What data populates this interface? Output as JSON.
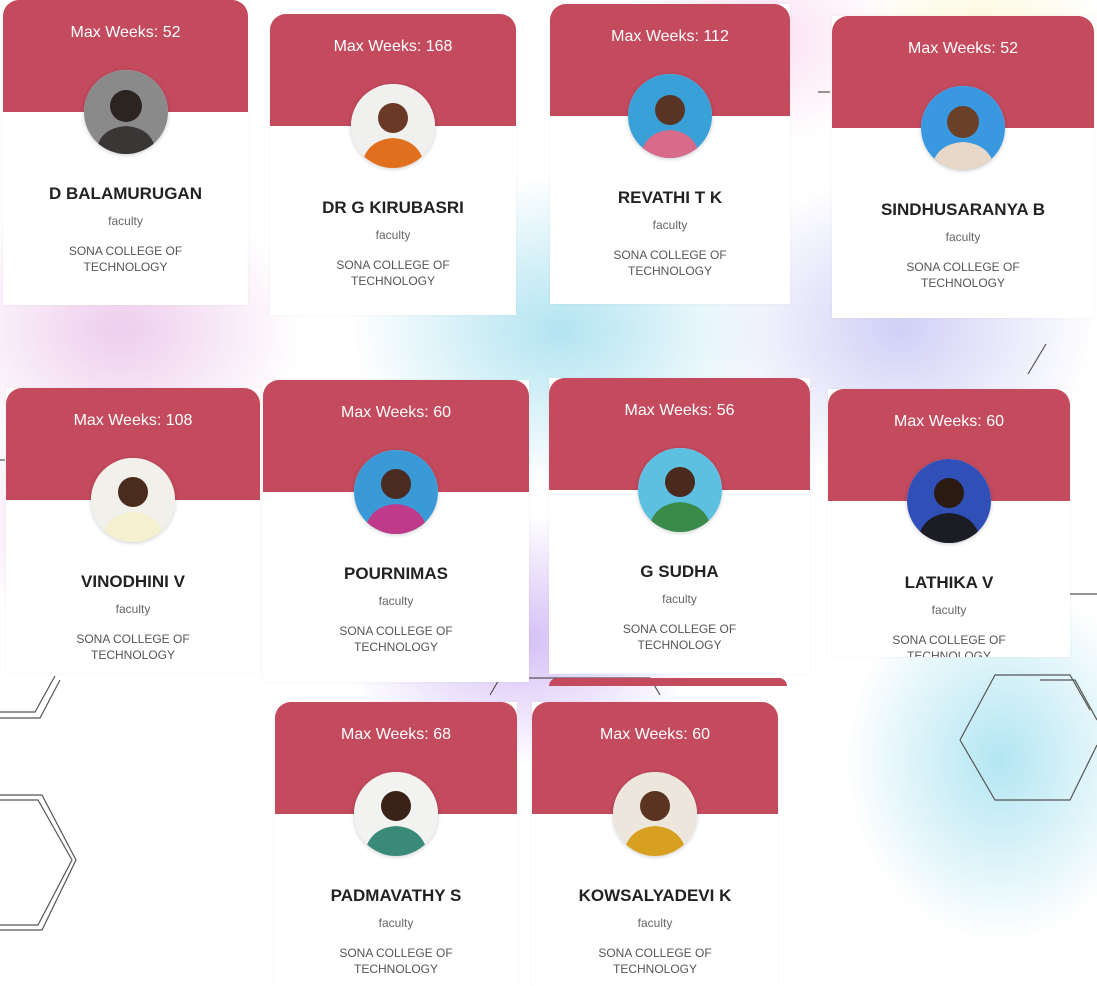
{
  "colors": {
    "card_header": "#c44a5e",
    "card_body": "#ffffff",
    "name_text": "#222222",
    "meta_text": "#666666"
  },
  "cards": [
    {
      "weeks": "Max Weeks: 52",
      "name": "D BALAMURUGAN",
      "role": "faculty",
      "college": "SONA COLLEGE OF TECHNOLOGY",
      "avatar": "faculty-photo"
    },
    {
      "weeks": "Max Weeks: 168",
      "name": "DR G KIRUBASRI",
      "role": "faculty",
      "college": "SONA COLLEGE OF TECHNOLOGY",
      "avatar": "faculty-photo"
    },
    {
      "weeks": "Max Weeks: 112",
      "name": "REVATHI T K",
      "role": "faculty",
      "college": "SONA COLLEGE OF TECHNOLOGY",
      "avatar": "faculty-photo"
    },
    {
      "weeks": "Max Weeks: 52",
      "name": "SINDHUSARANYA B",
      "role": "faculty",
      "college": "SONA COLLEGE OF TECHNOLOGY",
      "avatar": "faculty-photo"
    },
    {
      "weeks": "Max Weeks: 108",
      "name": "VINODHINI V",
      "role": "faculty",
      "college": "SONA COLLEGE OF TECHNOLOGY",
      "avatar": "faculty-photo"
    },
    {
      "weeks": "Max Weeks: 60",
      "name": "POURNIMAS",
      "role": "faculty",
      "college": "SONA COLLEGE OF TECHNOLOGY",
      "avatar": "faculty-photo"
    },
    {
      "weeks": "Max Weeks: 56",
      "name": "G SUDHA",
      "role": "faculty",
      "college": "SONA COLLEGE OF TECHNOLOGY",
      "avatar": "faculty-photo"
    },
    {
      "weeks": "Max Weeks: 60",
      "name": "LATHIKA V",
      "role": "faculty",
      "college": "SONA COLLEGE OF TECHNOLOGY",
      "avatar": "faculty-photo"
    },
    {
      "weeks": "Max Weeks: 68",
      "name": "PADMAVATHY S",
      "role": "faculty",
      "college": "SONA COLLEGE OF TECHNOLOGY",
      "avatar": "faculty-photo"
    },
    {
      "weeks": "Max Weeks: 60",
      "name": "KOWSALYADEVI K",
      "role": "faculty",
      "college": "SONA COLLEGE OF TECHNOLOGY",
      "avatar": "faculty-photo"
    }
  ]
}
